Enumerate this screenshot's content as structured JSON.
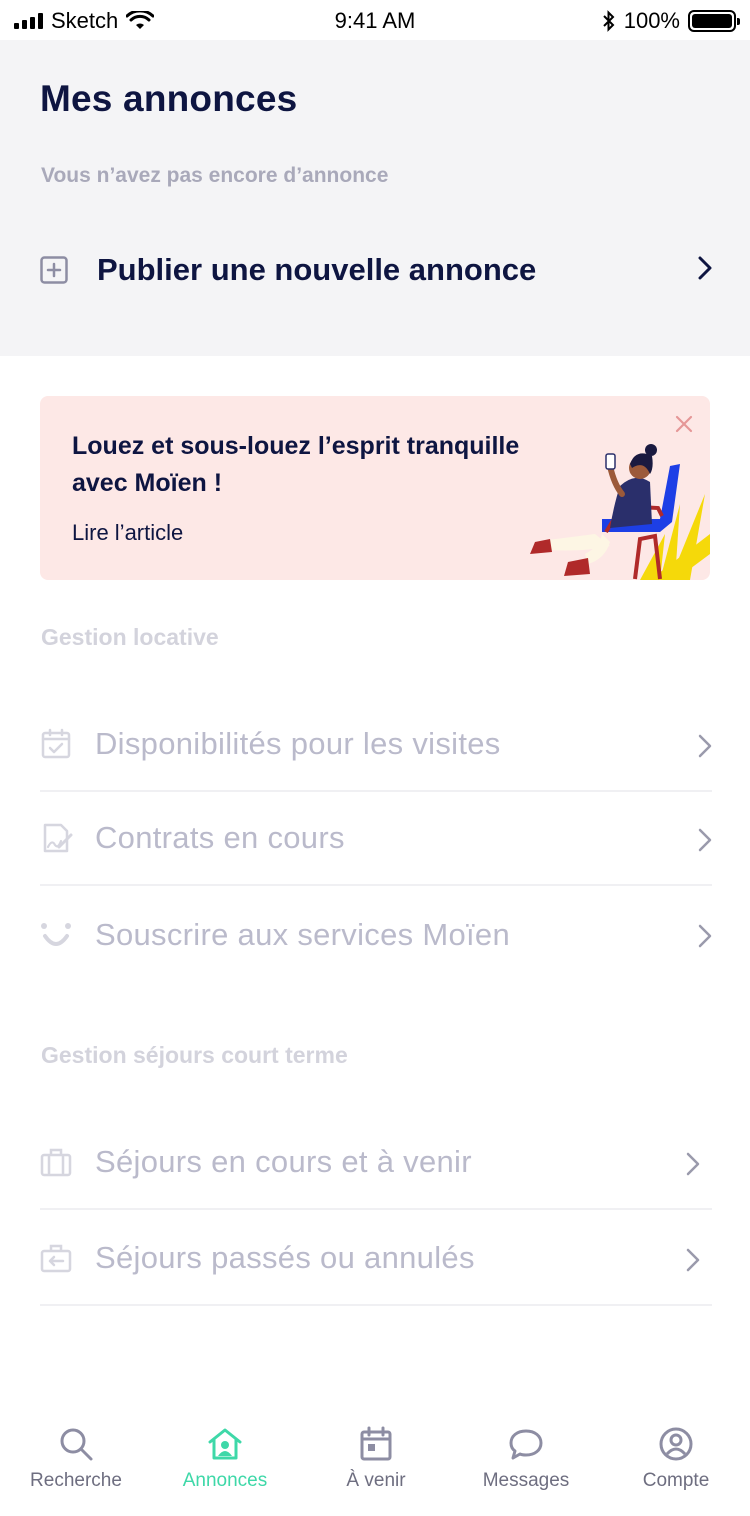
{
  "status_bar": {
    "carrier": "Sketch",
    "time": "9:41 AM",
    "battery": "100%"
  },
  "header": {
    "title": "Mes annonces",
    "empty_note": "Vous n’avez pas encore d’annonce",
    "publish_label": "Publier une nouvelle annonce"
  },
  "promo": {
    "title": "Louez et sous-louez l’esprit tranquille avec Moïen !",
    "link": "Lire l’article"
  },
  "gestion_locative": {
    "title": "Gestion locative",
    "items": [
      {
        "label": "Disponibilités pour les visites",
        "icon": "calendar-check-icon"
      },
      {
        "label": "Contrats en cours",
        "icon": "contract-sign-icon"
      },
      {
        "label": "Souscrire aux services Moïen",
        "icon": "moien-logo-icon"
      }
    ]
  },
  "gestion_sejours": {
    "title": "Gestion séjours court terme",
    "items": [
      {
        "label": "Séjours en cours et à venir",
        "icon": "briefcase-icon"
      },
      {
        "label": "Séjours passés ou annulés",
        "icon": "briefcase-return-icon"
      }
    ]
  },
  "tabs": [
    {
      "label": "Recherche",
      "icon": "search-icon",
      "active": false
    },
    {
      "label": "Annonces",
      "icon": "home-user-icon",
      "active": true
    },
    {
      "label": "À venir",
      "icon": "calendar-icon",
      "active": false
    },
    {
      "label": "Messages",
      "icon": "chat-bubble-icon",
      "active": false
    },
    {
      "label": "Compte",
      "icon": "account-icon",
      "active": false
    }
  ],
  "colors": {
    "primary_text": "#0e1541",
    "muted_text": "#a9a9ba",
    "disabled_text": "#babacb",
    "header_bg": "#f4f4f6",
    "promo_bg": "#fde8e6",
    "accent": "#3ed8a8"
  }
}
